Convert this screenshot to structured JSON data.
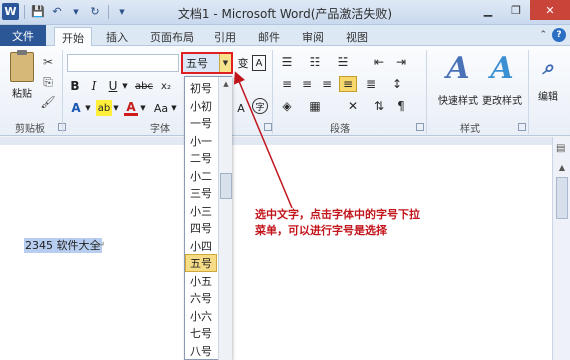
{
  "window": {
    "title": "文档1 - Microsoft Word(产品激活失败)",
    "logo_letter": "W",
    "minimize": "▁",
    "restore": "❐",
    "close": "✕"
  },
  "tabs": {
    "file": "文件",
    "items": [
      "开始",
      "插入",
      "页面布局",
      "引用",
      "邮件",
      "审阅",
      "视图"
    ]
  },
  "ribbon": {
    "clipboard": {
      "paste": "粘贴",
      "group": "剪贴板"
    },
    "font": {
      "group": "字体",
      "size_value": "五号",
      "bold": "B",
      "italic": "I",
      "underline": "U",
      "strikethrough": "abc",
      "subscript": "x₂",
      "change_case": "Aa",
      "phonetic": "变",
      "border_char": "A",
      "enclose_char": "字",
      "font_color": "A",
      "highlight": "ab"
    },
    "paragraph": {
      "group": "段落"
    },
    "styles": {
      "group": "样式",
      "quick": "快速样式",
      "change": "更改样式"
    },
    "editing": {
      "label": "编辑"
    }
  },
  "font_size_list": [
    "初号",
    "小初",
    "一号",
    "小一",
    "二号",
    "小二",
    "三号",
    "小三",
    "四号",
    "小四",
    "五号",
    "小五",
    "六号",
    "小六",
    "七号",
    "八号"
  ],
  "font_size_selected": "五号",
  "document": {
    "text": "2345 软件大全",
    "para_mark": "↵"
  },
  "annotation": {
    "text": "选中文字，点击字体中的字号下拉菜单，可以进行字号是选择"
  },
  "colors": {
    "accent": "#2b5797",
    "annotation": "#c2141b",
    "highlight": "#f7dc86"
  }
}
